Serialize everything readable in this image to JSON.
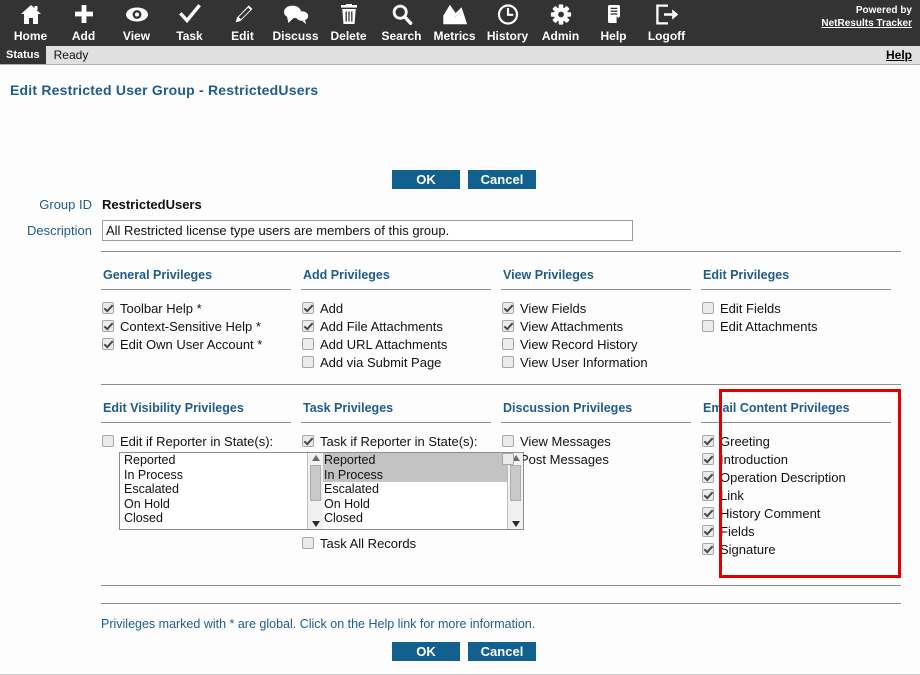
{
  "toolbar": {
    "items": [
      {
        "label": "Home",
        "icon": "home-icon"
      },
      {
        "label": "Add",
        "icon": "plus-icon"
      },
      {
        "label": "View",
        "icon": "eye-icon"
      },
      {
        "label": "Task",
        "icon": "check-icon"
      },
      {
        "label": "Edit",
        "icon": "pencil-icon"
      },
      {
        "label": "Discuss",
        "icon": "chat-bubbles-icon"
      },
      {
        "label": "Delete",
        "icon": "trash-icon"
      },
      {
        "label": "Search",
        "icon": "magnifier-icon"
      },
      {
        "label": "Metrics",
        "icon": "chart-icon"
      },
      {
        "label": "History",
        "icon": "clock-icon"
      },
      {
        "label": "Admin",
        "icon": "gear-icon"
      },
      {
        "label": "Help",
        "icon": "book-icon"
      },
      {
        "label": "Logoff",
        "icon": "logout-icon"
      }
    ],
    "powered_by": "Powered by",
    "product_link": "NetResults Tracker"
  },
  "statusbar": {
    "label": "Status",
    "value": "Ready",
    "help": "Help"
  },
  "page": {
    "title": "Edit Restricted User Group - RestrictedUsers",
    "footnote": "Privileges marked with * are global. Click on the Help link for more information."
  },
  "buttons": {
    "ok": "OK",
    "cancel": "Cancel"
  },
  "form": {
    "group_id_label": "Group ID",
    "group_id_value": "RestrictedUsers",
    "description_label": "Description",
    "description_value": "All Restricted license type users are members of this group."
  },
  "colors": {
    "toolbar_bg": "#333333",
    "accent_blue": "#1f5c8b",
    "button_blue": "#11608d",
    "highlight_red": "#e00000"
  },
  "privileges": {
    "row1": [
      {
        "title": "General Privileges",
        "items": [
          {
            "label": "Toolbar Help *",
            "checked": true
          },
          {
            "label": "Context-Sensitive Help *",
            "checked": true
          },
          {
            "label": "Edit Own User Account *",
            "checked": true
          }
        ]
      },
      {
        "title": "Add Privileges",
        "items": [
          {
            "label": "Add",
            "checked": true
          },
          {
            "label": "Add File Attachments",
            "checked": true
          },
          {
            "label": "Add URL Attachments",
            "checked": false
          },
          {
            "label": "Add via Submit Page",
            "checked": false
          }
        ]
      },
      {
        "title": "View Privileges",
        "items": [
          {
            "label": "View Fields",
            "checked": true
          },
          {
            "label": "View Attachments",
            "checked": true
          },
          {
            "label": "View Record History",
            "checked": false
          },
          {
            "label": "View User Information",
            "checked": false
          }
        ]
      },
      {
        "title": "Edit Privileges",
        "items": [
          {
            "label": "Edit Fields",
            "checked": false
          },
          {
            "label": "Edit Attachments",
            "checked": false
          }
        ]
      }
    ],
    "row2": [
      {
        "title": "Edit Visibility Privileges",
        "items": [
          {
            "label": "Edit if Reporter in State(s):",
            "checked": false
          }
        ],
        "listbox": {
          "options": [
            "Reported",
            "In Process",
            "Escalated",
            "On Hold",
            "Closed"
          ],
          "selected": []
        }
      },
      {
        "title": "Task Privileges",
        "items": [
          {
            "label": "Task if Reporter in State(s):",
            "checked": true
          }
        ],
        "listbox": {
          "options": [
            "Reported",
            "In Process",
            "Escalated",
            "On Hold",
            "Closed"
          ],
          "selected": [
            "Reported",
            "In Process"
          ]
        },
        "items_after": [
          {
            "label": "Task All Records",
            "checked": false
          }
        ]
      },
      {
        "title": "Discussion Privileges",
        "items": [
          {
            "label": "View Messages",
            "checked": false
          },
          {
            "label": "Post Messages",
            "checked": false
          }
        ]
      },
      {
        "title": "Email Content Privileges",
        "highlighted": true,
        "items": [
          {
            "label": "Greeting",
            "checked": true
          },
          {
            "label": "Introduction",
            "checked": true
          },
          {
            "label": "Operation Description",
            "checked": true
          },
          {
            "label": "Link",
            "checked": true
          },
          {
            "label": "History Comment",
            "checked": true
          },
          {
            "label": "Fields",
            "checked": true
          },
          {
            "label": "Signature",
            "checked": true
          }
        ]
      }
    ]
  }
}
